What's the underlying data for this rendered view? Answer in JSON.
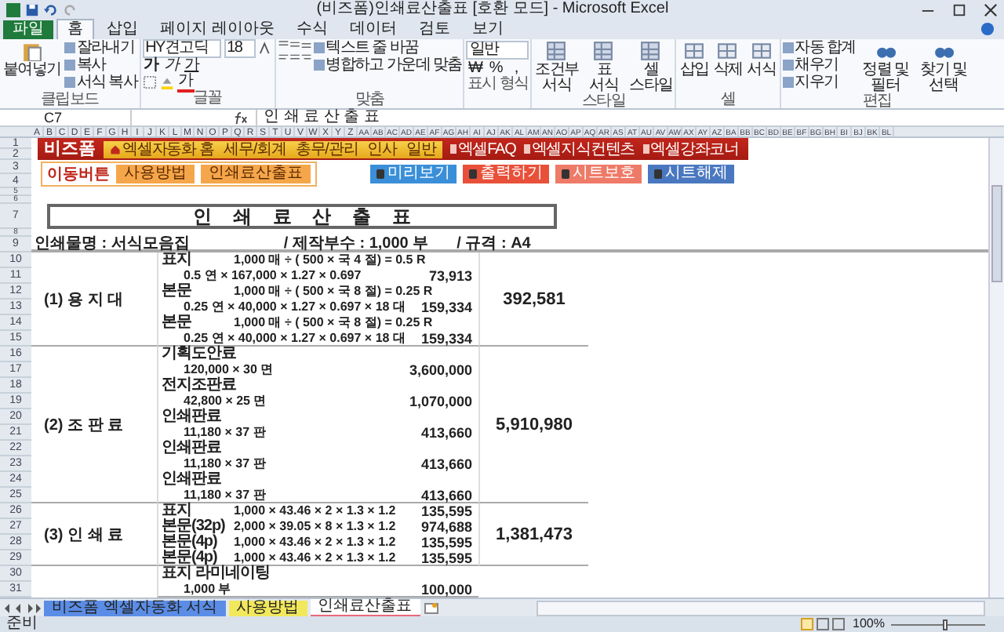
{
  "window": {
    "title": "(비즈폼)인쇄료산출표  [호환 모드]  -  Microsoft Excel"
  },
  "tabs": [
    {
      "label": "파일",
      "kind": "file",
      "selected": false
    },
    {
      "label": "홈",
      "kind": "tab",
      "selected": true
    },
    {
      "label": "삽입",
      "kind": "tab",
      "selected": false
    },
    {
      "label": "페이지 레이아웃",
      "kind": "tab",
      "selected": false
    },
    {
      "label": "수식",
      "kind": "tab",
      "selected": false
    },
    {
      "label": "데이터",
      "kind": "tab",
      "selected": false
    },
    {
      "label": "검토",
      "kind": "tab",
      "selected": false
    },
    {
      "label": "보기",
      "kind": "tab",
      "selected": false
    }
  ],
  "ribbon": {
    "clipboard": {
      "paste": "붙여넣기",
      "items": [
        "잘라내기",
        "복사",
        "서식 복사"
      ],
      "label": "클립보드"
    },
    "font": {
      "family": "HY견고딕",
      "size": "18",
      "styles": [
        "가",
        "가",
        "가"
      ],
      "color_letter": "가",
      "label": "글꼴"
    },
    "alignment": {
      "wrap": "텍스트 줄 바꿈",
      "merge": "병합하고 가운데 맞춤",
      "label": "맞춤"
    },
    "number": {
      "format": "일반",
      "symbols": [
        "₩",
        "%",
        ","
      ],
      "label": "표시 형식"
    },
    "styles": {
      "items": [
        "조건부 서식",
        "표 서식",
        "셀 스타일"
      ],
      "label": "스타일"
    },
    "cells": {
      "items": [
        "삽입",
        "삭제",
        "서식"
      ],
      "label": "셀"
    },
    "editing": {
      "items": [
        "자동 합계",
        "채우기",
        "지우기"
      ],
      "big": [
        "정렬 및 필터",
        "찾기 및 선택"
      ],
      "label": "편집"
    }
  },
  "formula_bar": {
    "cell": "C7",
    "value": "인 쇄 료 산 출 표"
  },
  "columns": [
    "A",
    "B",
    "C",
    "D",
    "E",
    "F",
    "G",
    "H",
    "I",
    "J",
    "K",
    "L",
    "M",
    "N",
    "O",
    "P",
    "Q",
    "R",
    "S",
    "T",
    "U",
    "V",
    "W",
    "X",
    "Y",
    "Z",
    "AA",
    "AB",
    "AC",
    "AD",
    "AE",
    "AF",
    "AG",
    "AH",
    "AI",
    "AJ",
    "AK",
    "AL",
    "AM",
    "AN",
    "AO",
    "AP",
    "AQ",
    "AR",
    "AS",
    "AT",
    "AU",
    "AV",
    "AW",
    "AX",
    "AY",
    "AZ",
    "BA",
    "BB",
    "BC",
    "BD",
    "BE",
    "BF",
    "BG",
    "BH",
    "BI",
    "BJ",
    "BK",
    "BL"
  ],
  "rows": [
    "1",
    "2",
    "3",
    "4",
    "5",
    "6",
    "7",
    "8",
    "9",
    "10",
    "11",
    "12",
    "13",
    "14",
    "15",
    "16",
    "17",
    "18",
    "19",
    "20",
    "21",
    "22",
    "23",
    "24",
    "25",
    "26",
    "27",
    "28",
    "29",
    "30",
    "31"
  ],
  "banner": {
    "logo": "비즈폼",
    "nav": [
      {
        "label": "엑셀자동화 홈",
        "kind": "home"
      },
      {
        "label": "세무/회계",
        "kind": "plain"
      },
      {
        "label": "총무/관리",
        "kind": "plain"
      },
      {
        "label": "인사",
        "kind": "plain"
      },
      {
        "label": "일반",
        "kind": "plain"
      }
    ],
    "links": [
      "엑셀FAQ",
      "엑셀지식컨텐츠",
      "엑셀강좌코너"
    ]
  },
  "menu": {
    "label": "이동버튼",
    "buttons": [
      "사용방법",
      "인쇄료산출표"
    ]
  },
  "actions": [
    {
      "label": "미리보기",
      "color": "#3a8fd8"
    },
    {
      "label": "출력하기",
      "color": "#e8503a"
    },
    {
      "label": "시트보호",
      "color": "#ee7a68"
    },
    {
      "label": "시트해제",
      "color": "#4a78c0"
    }
  ],
  "sheet_title": "인 쇄 료 산 출 표",
  "info": [
    "인쇄물명 :  서식모음집",
    "/ 제작부수 :  1,000  부",
    "/ 규격 :  A4"
  ],
  "sections": [
    {
      "label": "(1) 용 지 대",
      "total": "392,581",
      "lines": [
        {
          "label": "표지",
          "formula": "1,000 매 ÷ ( 500 × 국 4 절) =  0.5 R"
        },
        {
          "formula": "0.5 연 × 167,000 × 1.27 × 0.697",
          "amount": "73,913"
        },
        {
          "label": "본문",
          "formula": "1,000 매 ÷ ( 500 × 국 8 절) =  0.25 R"
        },
        {
          "formula": "0.25 연 × 40,000 × 1.27 × 0.697 × 18 대",
          "amount": "159,334"
        },
        {
          "label": "본문",
          "formula": "1,000 매 ÷ ( 500 × 국 8 절) =  0.25 R"
        },
        {
          "formula": "0.25 연 × 40,000 × 1.27 × 0.697 × 18 대",
          "amount": "159,334"
        }
      ]
    },
    {
      "label": "(2) 조 판 료",
      "total": "5,910,980",
      "lines": [
        {
          "label": "기획도안료"
        },
        {
          "formula": "120,000 × 30 면",
          "amount": "3,600,000"
        },
        {
          "label": "전지조판료"
        },
        {
          "formula": "42,800 × 25 면",
          "amount": "1,070,000"
        },
        {
          "label": "인쇄판료"
        },
        {
          "formula": "11,180 × 37 판",
          "amount": "413,660"
        },
        {
          "label": "인쇄판료"
        },
        {
          "formula": "11,180 × 37 판",
          "amount": "413,660"
        },
        {
          "label": "인쇄판료"
        },
        {
          "formula": "11,180 × 37 판",
          "amount": "413,660"
        }
      ]
    },
    {
      "label": "(3) 인 쇄 료",
      "total": "1,381,473",
      "lines": [
        {
          "label": "표지",
          "formula": "1,000 × 43.46 × 2 × 1.3 × 1.2",
          "amount": "135,595"
        },
        {
          "label": "본문(32p)",
          "formula": "2,000 × 39.05 × 8 × 1.3 × 1.2",
          "amount": "974,688"
        },
        {
          "label": "본문(4p)",
          "formula": "1,000 × 43.46 × 2 × 1.3 × 1.2",
          "amount": "135,595"
        },
        {
          "label": "본문(4p)",
          "formula": "1,000 × 43.46 × 2 × 1.3 × 1.2",
          "amount": "135,595"
        }
      ]
    },
    {
      "lines": [
        {
          "label": "표지 라미네이팅"
        },
        {
          "formula": "1,000 부",
          "amount": "100,000"
        }
      ]
    }
  ],
  "sheet_tabs": [
    {
      "label": "비즈폼 엑셀자동화 서식",
      "color": "#5b8de6",
      "selected": false
    },
    {
      "label": "사용방법",
      "color": "#f2e85c",
      "selected": false
    },
    {
      "label": "인쇄료산출표",
      "color": "#e86a7a",
      "selected": true
    }
  ],
  "status": {
    "text": "준비",
    "zoom": "100%",
    "level": 0.55
  }
}
